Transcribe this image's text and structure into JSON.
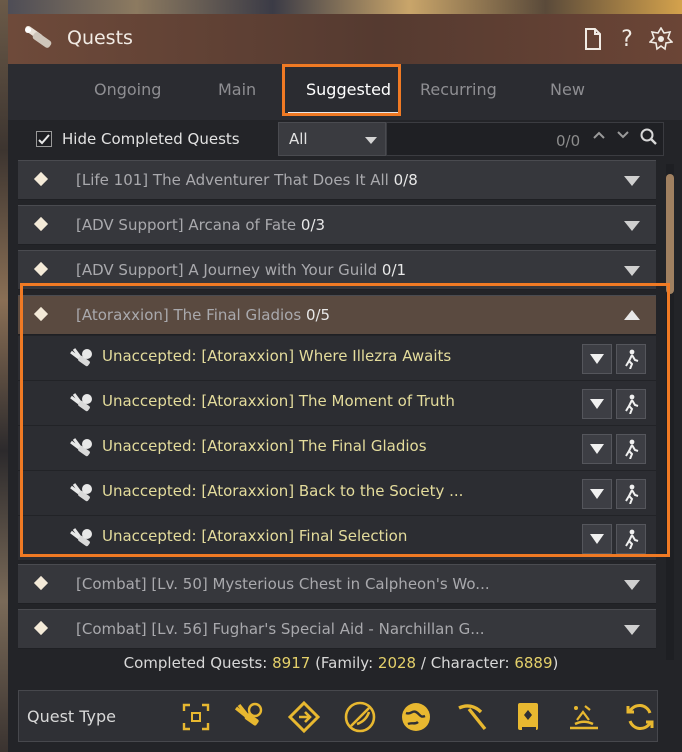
{
  "window": {
    "title": "Quests"
  },
  "tabs": [
    {
      "label": "Ongoing"
    },
    {
      "label": "Main"
    },
    {
      "label": "Suggested"
    },
    {
      "label": "Recurring"
    },
    {
      "label": "New"
    }
  ],
  "filter": {
    "hide_completed_label": "Hide Completed Quests",
    "hide_completed_checked": true,
    "select_value": "All",
    "search_count": "0/0"
  },
  "quests": [
    {
      "title": "[Life 101] The Adventurer That Does It All",
      "count": "0/8"
    },
    {
      "title": "[ADV Support] Arcana of Fate",
      "count": "0/3"
    },
    {
      "title": "[ADV Support] A Journey with Your Guild",
      "count": "0/1"
    },
    {
      "title": "[Atoraxxion] The Final Gladios",
      "count": "0/5"
    },
    {
      "title": "[Combat] [Lv. 50] Mysterious Chest in Calpheon's Wo...",
      "count": ""
    },
    {
      "title": "[Combat] [Lv. 56] Fughar's Special Aid - Narchillan G...",
      "count": ""
    }
  ],
  "subquests": [
    {
      "title": "Unaccepted: [Atoraxxion] Where Illezra Awaits"
    },
    {
      "title": "Unaccepted: [Atoraxxion] The Moment of Truth"
    },
    {
      "title": "Unaccepted: [Atoraxxion] The Final Gladios"
    },
    {
      "title": "Unaccepted: [Atoraxxion] Back to the Society ..."
    },
    {
      "title": "Unaccepted: [Atoraxxion] Final Selection"
    }
  ],
  "footer": {
    "prefix": "Completed Quests: ",
    "total": "8917",
    "family_label": " (Family: ",
    "family": "2028",
    "sep": " / Character: ",
    "character": "6889",
    "suffix": ")"
  },
  "quest_type": {
    "label": "Quest Type",
    "icons": [
      "focus-icon",
      "scroll-icon",
      "diamond-arrow-icon",
      "combat-icon",
      "globe-icon",
      "pickaxe-icon",
      "book-icon",
      "fishing-icon",
      "repeat-icon"
    ]
  },
  "colors": {
    "accent": "#f07a24",
    "subquest_text": "#e4dc9c",
    "count_highlight": "#e4d06a"
  }
}
